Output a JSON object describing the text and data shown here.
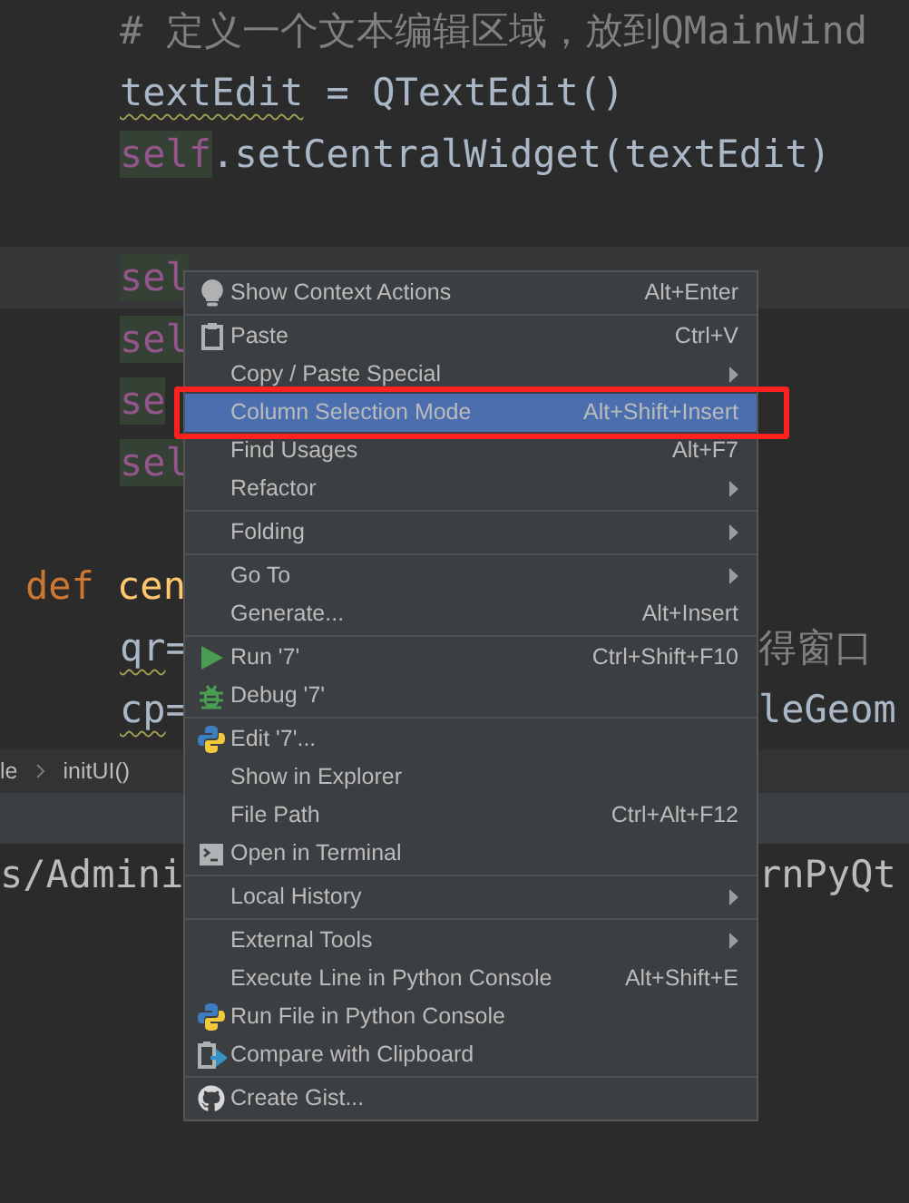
{
  "code_lines": [
    {
      "kind": "code",
      "indented": true,
      "current": false,
      "tokens": [
        {
          "kind": "comment",
          "text": "# 定义一个文本编辑区域，放到QMainWind"
        }
      ]
    },
    {
      "kind": "code",
      "indented": true,
      "current": false,
      "tokens": [
        {
          "kind": "warn",
          "text": "textEdit"
        },
        {
          "kind": "plain",
          "text": " = QTextEdit()"
        }
      ]
    },
    {
      "kind": "code",
      "indented": true,
      "current": false,
      "tokens": [
        {
          "kind": "self",
          "text": "self"
        },
        {
          "kind": "plain",
          "text": ".setCentralWidget(textEdit)"
        }
      ]
    },
    {
      "kind": "blank"
    },
    {
      "kind": "code",
      "indented": true,
      "current": true,
      "tokens": [
        {
          "kind": "self",
          "text": "sel"
        }
      ]
    },
    {
      "kind": "code",
      "indented": true,
      "current": false,
      "tokens": [
        {
          "kind": "self",
          "text": "sel"
        }
      ]
    },
    {
      "kind": "code",
      "indented": true,
      "current": false,
      "tokens": [
        {
          "kind": "self",
          "text": "se"
        }
      ]
    },
    {
      "kind": "code",
      "indented": true,
      "current": false,
      "tokens": [
        {
          "kind": "self",
          "text": "sel"
        }
      ]
    },
    {
      "kind": "blank"
    },
    {
      "kind": "code",
      "indented": false,
      "current": false,
      "tokens": [
        {
          "kind": "keyword",
          "text": "def"
        },
        {
          "kind": "func",
          "text": "cen"
        }
      ]
    },
    {
      "kind": "code",
      "indented": true,
      "current": false,
      "tokens": [
        {
          "kind": "warn",
          "text": "qr"
        },
        {
          "kind": "plain",
          "text": "="
        }
      ],
      "right": {
        "kind": "comment",
        "text": "得窗口"
      }
    },
    {
      "kind": "code",
      "indented": true,
      "current": false,
      "tokens": [
        {
          "kind": "warn",
          "text": "cp"
        },
        {
          "kind": "plain",
          "text": "="
        }
      ],
      "right": {
        "kind": "plain",
        "text": "leGeom"
      }
    }
  ],
  "breadcrumb": {
    "items": [
      "le",
      "initUI()"
    ]
  },
  "console": {
    "left": "s/Admini",
    "right": "rnPyQt"
  },
  "menu": [
    {
      "kind": "item",
      "label": "Show Context Actions",
      "shortcut": "Alt+Enter",
      "submenu": false,
      "selected": false,
      "annotated": false
    },
    {
      "kind": "separator"
    },
    {
      "kind": "item",
      "label": "Paste",
      "shortcut": "Ctrl+V",
      "submenu": false,
      "selected": false,
      "annotated": false
    },
    {
      "kind": "item",
      "label": "Copy / Paste Special",
      "submenu": true,
      "selected": false,
      "annotated": false
    },
    {
      "kind": "item",
      "label": "Column Selection Mode",
      "shortcut": "Alt+Shift+Insert",
      "submenu": false,
      "selected": true,
      "annotated": true
    },
    {
      "kind": "item",
      "label": "Find Usages",
      "shortcut": "Alt+F7",
      "submenu": false,
      "selected": false,
      "annotated": false
    },
    {
      "kind": "item",
      "label": "Refactor",
      "submenu": true,
      "selected": false,
      "annotated": false
    },
    {
      "kind": "separator"
    },
    {
      "kind": "item",
      "label": "Folding",
      "submenu": true,
      "selected": false,
      "annotated": false
    },
    {
      "kind": "separator"
    },
    {
      "kind": "item",
      "label": "Go To",
      "submenu": true,
      "selected": false,
      "annotated": false
    },
    {
      "kind": "item",
      "label": "Generate...",
      "shortcut": "Alt+Insert",
      "submenu": false,
      "selected": false,
      "annotated": false
    },
    {
      "kind": "separator"
    },
    {
      "kind": "item",
      "label": "Run '7'",
      "shortcut": "Ctrl+Shift+F10",
      "submenu": false,
      "selected": false,
      "annotated": false
    },
    {
      "kind": "item",
      "label": "Debug '7'",
      "submenu": false,
      "selected": false,
      "annotated": false
    },
    {
      "kind": "separator"
    },
    {
      "kind": "item",
      "label": "Edit '7'...",
      "submenu": false,
      "selected": false,
      "annotated": false
    },
    {
      "kind": "item",
      "label": "Show in Explorer",
      "submenu": false,
      "selected": false,
      "annotated": false
    },
    {
      "kind": "item",
      "label": "File Path",
      "shortcut": "Ctrl+Alt+F12",
      "submenu": false,
      "selected": false,
      "annotated": false
    },
    {
      "kind": "item",
      "label": "Open in Terminal",
      "submenu": false,
      "selected": false,
      "annotated": false
    },
    {
      "kind": "separator"
    },
    {
      "kind": "item",
      "label": "Local History",
      "submenu": true,
      "selected": false,
      "annotated": false
    },
    {
      "kind": "separator"
    },
    {
      "kind": "item",
      "label": "External Tools",
      "submenu": true,
      "selected": false,
      "annotated": false
    },
    {
      "kind": "item",
      "label": "Execute Line in Python Console",
      "shortcut": "Alt+Shift+E",
      "submenu": false,
      "selected": false,
      "annotated": false
    },
    {
      "kind": "item",
      "label": "Run File in Python Console",
      "submenu": false,
      "selected": false,
      "annotated": false
    },
    {
      "kind": "item",
      "label": "Compare with Clipboard",
      "submenu": false,
      "selected": false,
      "annotated": false
    },
    {
      "kind": "separator"
    },
    {
      "kind": "item",
      "label": "Create Gist...",
      "submenu": false,
      "selected": false,
      "annotated": false
    }
  ]
}
